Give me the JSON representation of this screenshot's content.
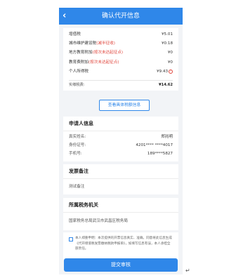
{
  "header": {
    "back_glyph": "‹",
    "title": "确认代开信息"
  },
  "taxes": [
    {
      "name": "增值税",
      "note": "",
      "amount": "¥5.01"
    },
    {
      "name": "城市维护建设税",
      "note": "(减半征收)",
      "amount": "¥0.18"
    },
    {
      "name": "地方教育附加",
      "note": "(按次未达起征点)",
      "amount": "¥0"
    },
    {
      "name": "教育费附加",
      "note": "(按次未达起征点)",
      "amount": "¥0"
    },
    {
      "name": "个人所得税",
      "note": "",
      "amount": "¥9.43"
    }
  ],
  "info_icon_glyph": "!",
  "total": {
    "label": "实缴税费:",
    "amount": "¥14.62"
  },
  "detail_button_label": "查看具体税额信息",
  "applicant": {
    "title": "申请人信息",
    "rows": [
      {
        "label": "真实姓名:",
        "value": "郑兆明"
      },
      {
        "label": "身份证号:",
        "value": "4201**** ****4017"
      },
      {
        "label": "手机号:",
        "value": "189****5827"
      }
    ]
  },
  "remarks": {
    "title": "发票备注",
    "text": "测试备注"
  },
  "authority": {
    "title": "所属税务机关",
    "text": "国家税务总局武汉市武昌区税务局"
  },
  "declaration": {
    "text": "本人郑重申明：本次提供的开票信息真实、准确。同意将此信息生成《代开增值税发票缴纳税款申报单》，如填写信息有误，本人承担全部责任。"
  },
  "submit_label": "提交审核",
  "return_mark": "↵",
  "colors": {
    "brand_blue": "#2f87e9",
    "warning_red": "#e0463d",
    "page_bg": "#f2f4f7"
  },
  "icons": {
    "back": "chevron-left-icon",
    "info": "warning-info-icon",
    "checkbox": "checkbox-unchecked"
  }
}
